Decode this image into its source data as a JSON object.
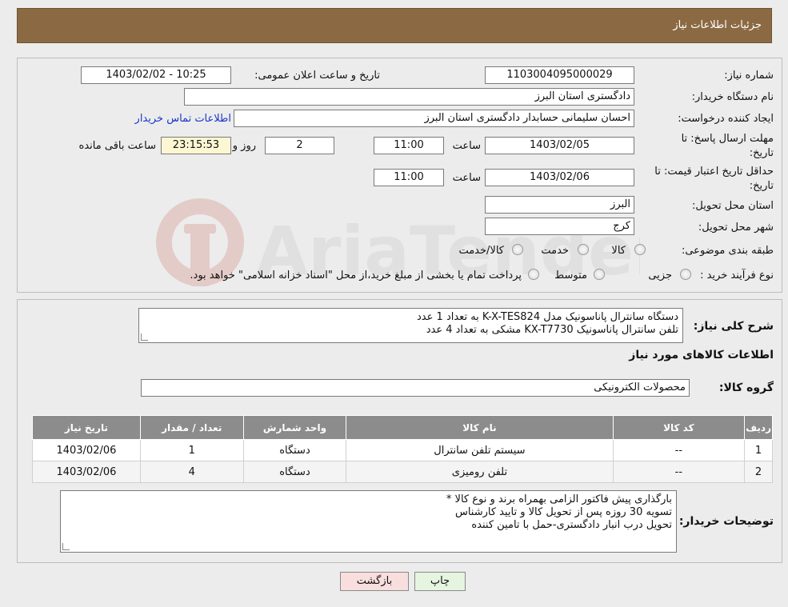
{
  "header": {
    "title": "جزئیات اطلاعات نیاز"
  },
  "fields": {
    "need_number_label": "شماره نیاز:",
    "need_number": "1103004095000029",
    "announce_label": "تاریخ و ساعت اعلان عمومی:",
    "announce_value": "1403/02/02 - 10:25",
    "buyer_org_label": "نام دستگاه خریدار:",
    "buyer_org": "دادگستری استان البرز",
    "creator_label": "ایجاد کننده درخواست:",
    "creator": "احسان سلیمانی حسابدار دادگستری استان البرز",
    "contact_link": "اطلاعات تماس خریدار",
    "reply_deadline_label_1": "مهلت ارسال پاسخ: تا",
    "reply_deadline_label_2": "تاریخ:",
    "reply_date": "1403/02/05",
    "time_label": "ساعت",
    "reply_time": "11:00",
    "days_value": "2",
    "days_label": "روز و",
    "remaining_value": "23:15:53",
    "remaining_label": "ساعت باقی مانده",
    "price_validity_label_1": "حداقل تاریخ اعتبار قیمت: تا",
    "price_validity_label_2": "تاریخ:",
    "price_date": "1403/02/06",
    "price_time": "11:00",
    "province_label": "استان محل تحویل:",
    "province": "البرز",
    "city_label": "شهر محل تحویل:",
    "city": "کرج",
    "category_label": "طبقه بندی موضوعی:",
    "category_options": [
      "کالا",
      "خدمت",
      "کالا/خدمت"
    ],
    "purchase_type_label": "نوع فرآیند خرید :",
    "purchase_options": [
      "جزیی",
      "متوسط"
    ],
    "purchase_note": "پرداخت تمام یا بخشی از مبلغ خرید،از محل \"اسناد خزانه اسلامی\" خواهد بود."
  },
  "description": {
    "label": "شرح کلی نیاز:",
    "lines": [
      "دستگاه سانترال پاناسونیک مدل K-X-TES824 به تعداد 1 عدد",
      "تلفن سانترال پاناسونیک KX-T7730 مشکی به تعداد 4 عدد"
    ]
  },
  "goods_section_title": "اطلاعات کالاهای مورد نیاز",
  "goods_group": {
    "label": "گروه کالا:",
    "value": "محصولات الکترونیکی"
  },
  "table": {
    "headers": [
      "ردیف",
      "کد کالا",
      "نام کالا",
      "واحد شمارش",
      "تعداد / مقدار",
      "تاریخ نیاز"
    ],
    "rows": [
      [
        "1",
        "--",
        "سیستم تلفن سانترال",
        "دستگاه",
        "1",
        "1403/02/06"
      ],
      [
        "2",
        "--",
        "تلفن رومیزی",
        "دستگاه",
        "4",
        "1403/02/06"
      ]
    ]
  },
  "buyer_notes": {
    "label": "توضیحات خریدار:",
    "lines": [
      "بارگذاری پیش فاکتور الزامی بهمراه برند و نوع کالا *",
      "تسویه 30 روزه پس از تحویل کالا و تایید کارشناس",
      "تحویل درب انبار دادگستری-حمل با تامین کننده"
    ]
  },
  "buttons": {
    "print": "چاپ",
    "back": "بازگشت"
  },
  "watermark_text": "AriaTender.neT",
  "colors": {
    "header_bg": "#8b6a43",
    "table_header_bg": "#8c8c8c",
    "back_button_bg": "#f9dede",
    "print_button_bg": "#e6f5e0",
    "link": "#1a35c9"
  }
}
